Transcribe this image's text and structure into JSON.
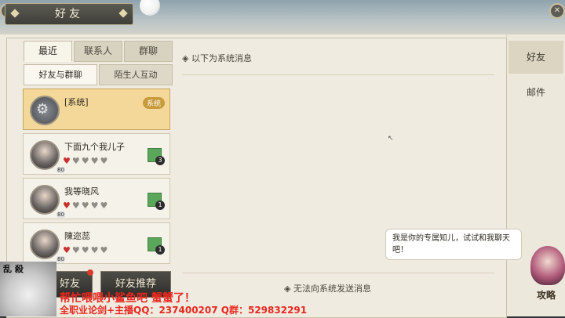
{
  "window": {
    "title": "好友"
  },
  "tabs": [
    "最近",
    "联系人",
    "群聊"
  ],
  "subtabs": [
    "好友与群聊",
    "陌生人互动"
  ],
  "friends": [
    {
      "name": "[系统]",
      "badge": "系统",
      "type": "system"
    },
    {
      "name": "下面九个我儿子",
      "level": "80",
      "hearts_filled": 1,
      "hearts_total": 5,
      "gift_count": "3"
    },
    {
      "name": "我等晓风",
      "level": "80",
      "hearts_filled": 1,
      "hearts_total": 5,
      "gift_count": "1"
    },
    {
      "name": "陳迩蕊",
      "level": "80",
      "hearts_filled": 1,
      "hearts_total": 5,
      "gift_count": "1"
    }
  ],
  "messages": {
    "header": "以下为系统消息",
    "footer": "无法向系统发送消息"
  },
  "side_tabs": [
    "好友",
    "邮件"
  ],
  "helper": {
    "bubble_text": "我是你的专属知儿，试试和我聊天吧！",
    "label": "攻略"
  },
  "bottom_buttons": [
    "好友",
    "好友推荐"
  ],
  "overlay": {
    "logo_text": "乱 殺",
    "line1": "帮忙喂喂小鲨鱼吧 蟹蟹了！",
    "line2": "全职业论剑+主播QQ：237400207 Q群：529832291"
  },
  "colors": {
    "selected_item": "#f4d89a",
    "system_badge": "#c79a3a",
    "heart_active": "#c8302b",
    "overlay_text": "#e8281f"
  }
}
